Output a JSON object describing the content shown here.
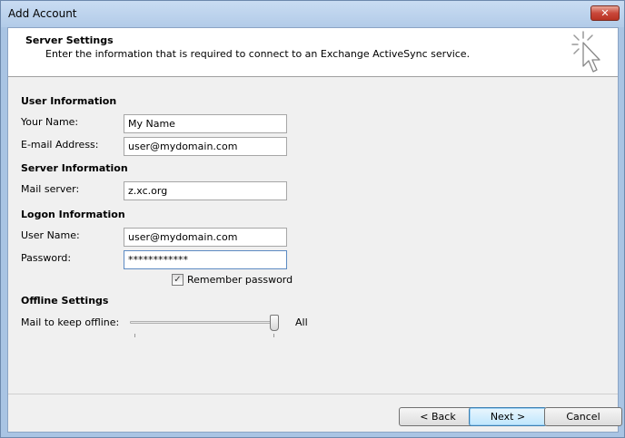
{
  "window": {
    "title": "Add Account",
    "close_glyph": "✕"
  },
  "header": {
    "title": "Server Settings",
    "description": "Enter the information that is required to connect to an Exchange ActiveSync service.",
    "icon": "cursor-click-icon"
  },
  "user_info": {
    "section_title": "User Information",
    "name_label": "Your Name:",
    "name_value": "My Name",
    "email_label": "E-mail Address:",
    "email_value": "user@mydomain.com"
  },
  "server_info": {
    "section_title": "Server Information",
    "mail_server_label": "Mail server:",
    "mail_server_value": "z.xc.org"
  },
  "logon_info": {
    "section_title": "Logon Information",
    "username_label": "User Name:",
    "username_value": "user@mydomain.com",
    "password_label": "Password:",
    "password_value": "************",
    "remember_label": "Remember password",
    "remember_checked": true
  },
  "offline": {
    "section_title": "Offline Settings",
    "slider_label": "Mail to keep offline:",
    "slider_value": "All",
    "slider_position_fraction": 1.0
  },
  "buttons": {
    "back": "< Back",
    "next": "Next >",
    "cancel": "Cancel"
  },
  "colors": {
    "title_bar": "#b9d1ea",
    "close_button": "#c9483a",
    "dialog_bg": "#f0f0f0"
  }
}
